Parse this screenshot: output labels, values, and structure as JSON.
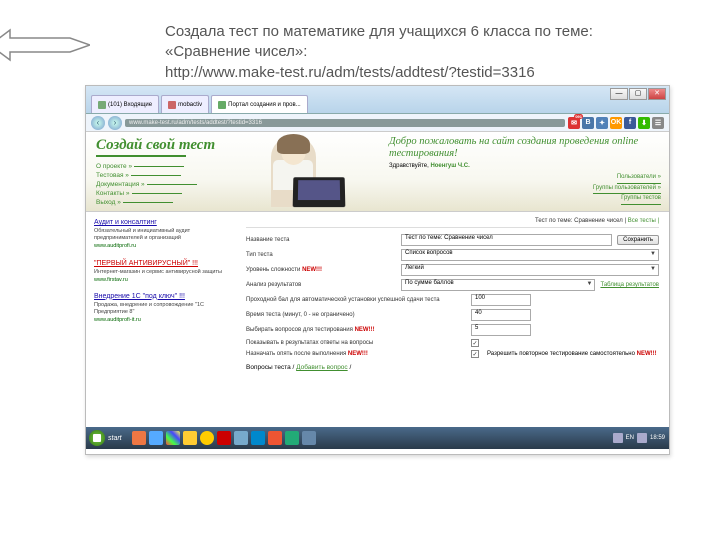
{
  "caption": {
    "line1": "Создала тест по математике для учащихся 6 класса по теме: «Сравнение чисел»:",
    "line2": "http://www.make-test.ru/adm/tests/addtest/?testid=3316"
  },
  "browser": {
    "tab1": "(101) Входящие",
    "tab2": "mobactiv",
    "tab3": "Портал создания и пров...",
    "url": "www.make-test.ru/adm/tests/addtest/?testid=3316",
    "notif_count": "091"
  },
  "site": {
    "logo": "Создай свой тест",
    "menu": [
      "О проекте »",
      "Тестовая »",
      "Документация »",
      "Контакты »",
      "Выход »"
    ],
    "welcome": "Добро пожаловать на сайт создания проведения online тестирования!",
    "greet_label": "Здравствуйте,",
    "greet_name": "Ноенгуш Ч.С.",
    "sidelinks": [
      "Пользователи »",
      "Группы пользователей »",
      "Группы тестов"
    ]
  },
  "ads": [
    {
      "title": "Аудит и консалтинг",
      "desc": "Обязательный и инициативный аудит предпринимателей и организаций",
      "url": "www.auditprofi.ru"
    },
    {
      "title": "\"ПЕРВЫЙ АНТИВИРУСНЫЙ\" !!!",
      "desc": "Интернет-магазин и сервис антивирусной защиты",
      "url": "www.firstav.ru"
    },
    {
      "title": "Внедрение 1С \"под ключ\" !!!",
      "desc": "Продажа, внедрение и сопровождение \"1С Предприятие 8\"",
      "url": "www.auditprofi-it.ru"
    }
  ],
  "breadcrumb": {
    "pre": "Тест по теме: Сравнение чисел |",
    "link": "Все тесты |"
  },
  "form": {
    "f1_label": "Название теста",
    "f1_val": "Тест по теме: Сравнение чисел",
    "save": "Сохранить",
    "f2_label": "Тип теста",
    "f2_val": "Список вопросов",
    "f3_label": "Уровень сложности",
    "f3_new": "NEW!!!",
    "f3_val": "Легкий",
    "f4_label": "Анализ результатов",
    "f4_val": "По сумме баллов",
    "f5_label": "Проходной бал для автоматической установки успешной сдачи теста",
    "f5_val": "100",
    "table_link": "Таблица результатов",
    "f6_label": "Время теста (минут, 0 - не ограничено)",
    "f6_val": "40",
    "f7_label": "Выбирать вопросов для тестирования",
    "f7_new": "NEW!!!",
    "f7_val": "5",
    "f8_label": "Показывать в результатах ответы на вопросы",
    "f9_label": "Назначать опять после выполнения",
    "f9_new": "NEW!!!",
    "f9_chk_label": "Разрешить повторное тестирование самостоятельно",
    "f9_chk_new": "NEW!!!",
    "addq_pre": "Вопросы теста /",
    "addq_link": "Добавить вопрос",
    "addq_post": "/"
  },
  "taskbar": {
    "start": "start",
    "lang": "EN",
    "time": "18:59"
  }
}
